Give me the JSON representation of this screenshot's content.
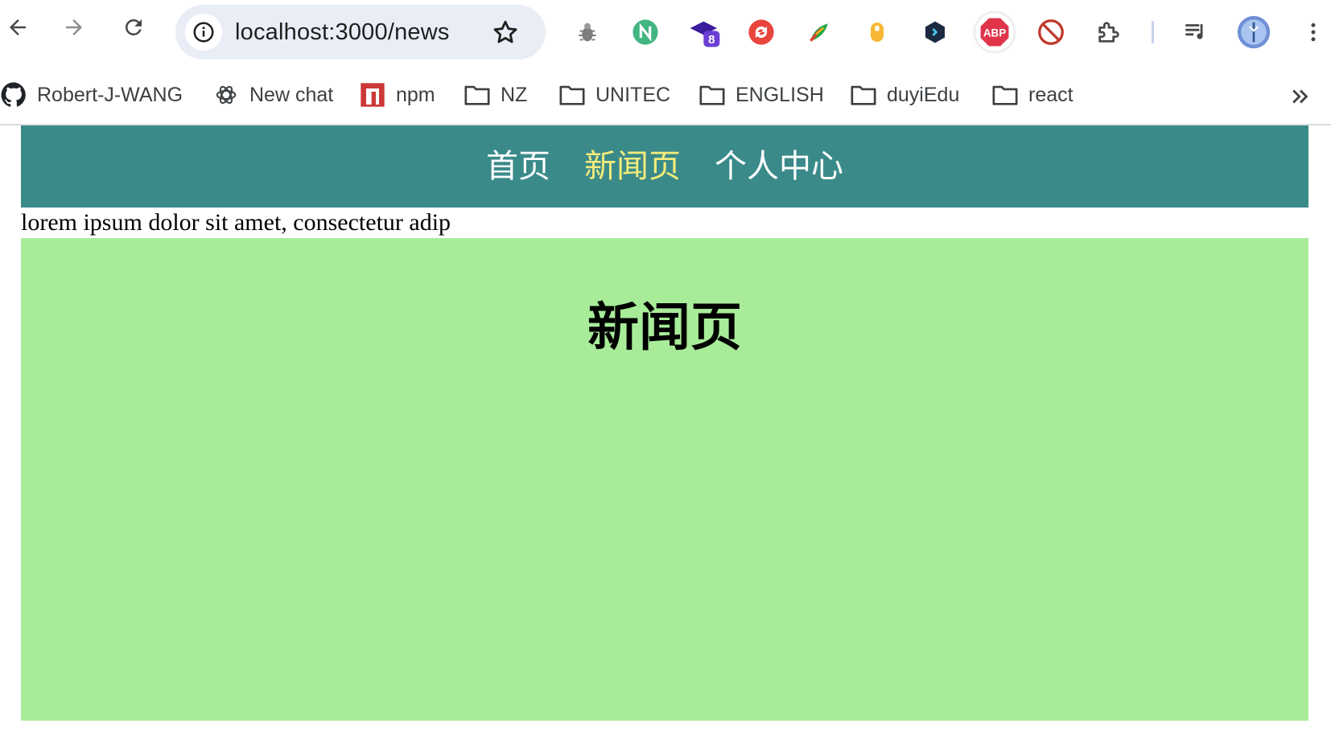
{
  "browser": {
    "url": "localhost:3000/news",
    "buttons": {
      "back": "back-arrow-icon",
      "forward": "forward-arrow-icon",
      "reload": "reload-icon"
    },
    "extension_badge": "8",
    "abp_label": "ABP",
    "extensions": [
      "bug-icon",
      "nuxt-icon",
      "grad-cap-icon",
      "sync-icon",
      "feather-icon",
      "mouse-icon",
      "code-icon",
      "adblock-plus-icon",
      "block-icon",
      "puzzle-icon",
      "playlist-icon",
      "avatar",
      "menu-icon"
    ]
  },
  "bookmarks": [
    {
      "label": "Robert-J-WANG",
      "icon": "github-icon"
    },
    {
      "label": "New chat",
      "icon": "openai-icon"
    },
    {
      "label": "npm",
      "icon": "npm-icon"
    },
    {
      "label": "NZ",
      "icon": "folder-icon"
    },
    {
      "label": "UNITEC",
      "icon": "folder-icon"
    },
    {
      "label": "ENGLISH",
      "icon": "folder-icon"
    },
    {
      "label": "duyiEdu",
      "icon": "folder-icon"
    },
    {
      "label": "react",
      "icon": "folder-icon"
    }
  ],
  "app": {
    "nav": [
      {
        "label": "首页",
        "active": false
      },
      {
        "label": "新闻页",
        "active": true
      },
      {
        "label": "个人中心",
        "active": false
      }
    ],
    "nav_bg": "#3b8a8a",
    "active_color": "#f3ec7a",
    "lorem": "lorem ipsum dolor sit amet, consectetur adip",
    "panel_bg": "#a8ec9a",
    "title": "新闻页"
  }
}
